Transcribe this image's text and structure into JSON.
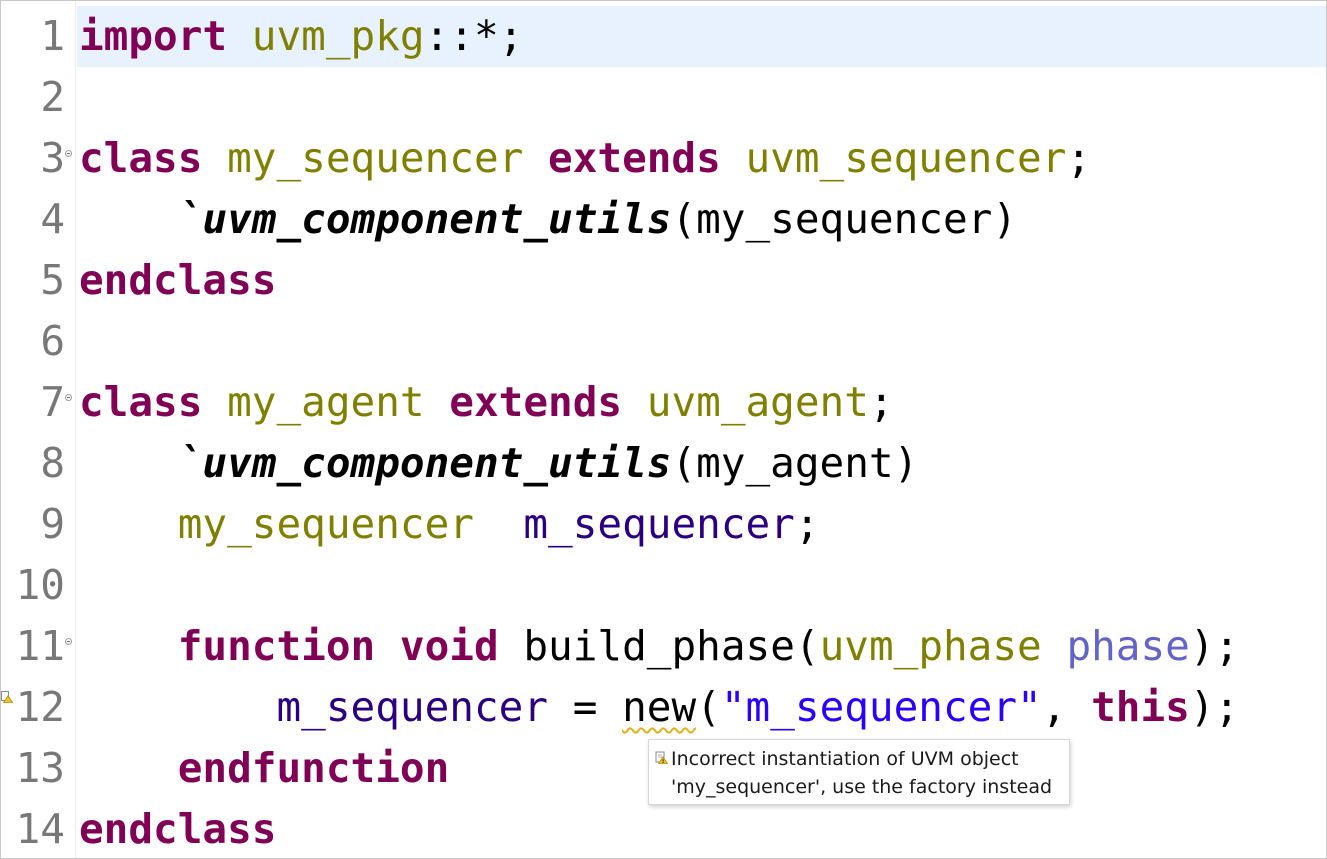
{
  "editor": {
    "lines": [
      {
        "n": "1",
        "tokens": [
          {
            "c": "kw",
            "t": "import"
          },
          {
            "c": "",
            "t": " "
          },
          {
            "c": "ty",
            "t": "uvm_pkg"
          },
          {
            "c": "",
            "t": "::*;"
          }
        ]
      },
      {
        "n": "2",
        "tokens": []
      },
      {
        "n": "3",
        "fold": true,
        "tokens": [
          {
            "c": "kw",
            "t": "class"
          },
          {
            "c": "",
            "t": " "
          },
          {
            "c": "ty",
            "t": "my_sequencer"
          },
          {
            "c": "",
            "t": " "
          },
          {
            "c": "kw",
            "t": "extends"
          },
          {
            "c": "",
            "t": " "
          },
          {
            "c": "ty",
            "t": "uvm_sequencer"
          },
          {
            "c": "",
            "t": ";"
          }
        ]
      },
      {
        "n": "4",
        "tokens": [
          {
            "c": "",
            "t": "    "
          },
          {
            "c": "mac",
            "t": "`uvm_component_utils"
          },
          {
            "c": "",
            "t": "(my_sequencer)"
          }
        ]
      },
      {
        "n": "5",
        "tokens": [
          {
            "c": "kw",
            "t": "endclass"
          }
        ]
      },
      {
        "n": "6",
        "tokens": []
      },
      {
        "n": "7",
        "fold": true,
        "tokens": [
          {
            "c": "kw",
            "t": "class"
          },
          {
            "c": "",
            "t": " "
          },
          {
            "c": "ty",
            "t": "my_agent"
          },
          {
            "c": "",
            "t": " "
          },
          {
            "c": "kw",
            "t": "extends"
          },
          {
            "c": "",
            "t": " "
          },
          {
            "c": "ty",
            "t": "uvm_agent"
          },
          {
            "c": "",
            "t": ";"
          }
        ]
      },
      {
        "n": "8",
        "tokens": [
          {
            "c": "",
            "t": "    "
          },
          {
            "c": "mac",
            "t": "`uvm_component_utils"
          },
          {
            "c": "",
            "t": "(my_agent)"
          }
        ]
      },
      {
        "n": "9",
        "tokens": [
          {
            "c": "",
            "t": "    "
          },
          {
            "c": "ty",
            "t": "my_sequencer"
          },
          {
            "c": "",
            "t": "  "
          },
          {
            "c": "var",
            "t": "m_sequencer"
          },
          {
            "c": "",
            "t": ";"
          }
        ]
      },
      {
        "n": "10",
        "tokens": []
      },
      {
        "n": "11",
        "fold": true,
        "tokens": [
          {
            "c": "",
            "t": "    "
          },
          {
            "c": "kw",
            "t": "function"
          },
          {
            "c": "",
            "t": " "
          },
          {
            "c": "kw",
            "t": "void"
          },
          {
            "c": "",
            "t": " build_phase("
          },
          {
            "c": "ty",
            "t": "uvm_phase"
          },
          {
            "c": "",
            "t": " "
          },
          {
            "c": "param",
            "t": "phase"
          },
          {
            "c": "",
            "t": ");"
          }
        ]
      },
      {
        "n": "12",
        "warning": true,
        "tokens": [
          {
            "c": "",
            "t": "        "
          },
          {
            "c": "var",
            "t": "m_sequencer"
          },
          {
            "c": "",
            "t": " = "
          },
          {
            "c": "squiggle",
            "t": "new"
          },
          {
            "c": "",
            "t": "("
          },
          {
            "c": "str",
            "t": "\"m_sequencer\""
          },
          {
            "c": "",
            "t": ", "
          },
          {
            "c": "kw",
            "t": "this"
          },
          {
            "c": "",
            "t": ");"
          }
        ]
      },
      {
        "n": "13",
        "tokens": [
          {
            "c": "",
            "t": "    "
          },
          {
            "c": "kw",
            "t": "endfunction"
          }
        ]
      },
      {
        "n": "14",
        "tokens": [
          {
            "c": "kw",
            "t": "endclass"
          }
        ]
      }
    ]
  },
  "tooltip": {
    "line1": "Incorrect instantiation of UVM object",
    "line2": "'my_sequencer', use the factory instead",
    "icon": "warning-icon"
  },
  "colors": {
    "keyword": "#7f0055",
    "type": "#808000",
    "variable": "#2a0080",
    "parameter": "#6464c8",
    "string": "#2a00ff",
    "current_line": "#e8f2fe",
    "warning": "#e0b020"
  }
}
